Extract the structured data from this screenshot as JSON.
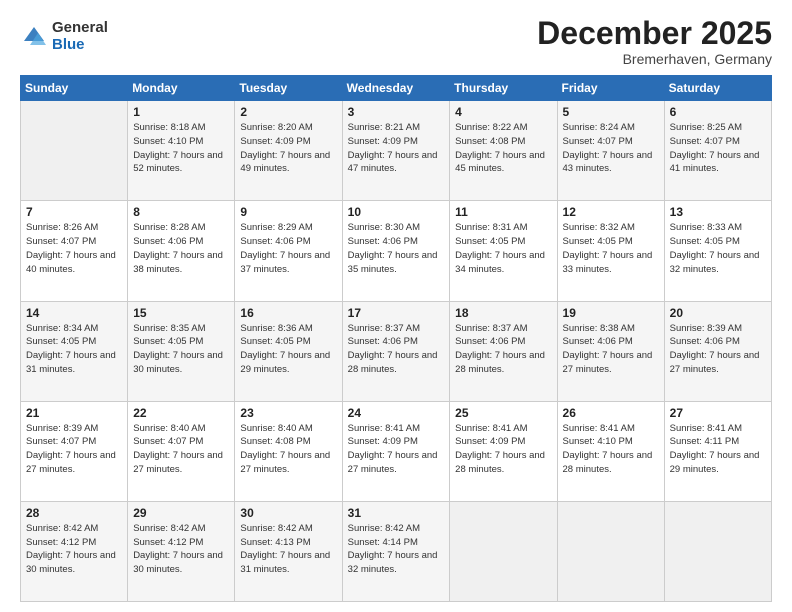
{
  "logo": {
    "general": "General",
    "blue": "Blue"
  },
  "header": {
    "title": "December 2025",
    "location": "Bremerhaven, Germany"
  },
  "weekdays": [
    "Sunday",
    "Monday",
    "Tuesday",
    "Wednesday",
    "Thursday",
    "Friday",
    "Saturday"
  ],
  "weeks": [
    [
      null,
      {
        "day": "1",
        "sunrise": "Sunrise: 8:18 AM",
        "sunset": "Sunset: 4:10 PM",
        "daylight": "Daylight: 7 hours and 52 minutes."
      },
      {
        "day": "2",
        "sunrise": "Sunrise: 8:20 AM",
        "sunset": "Sunset: 4:09 PM",
        "daylight": "Daylight: 7 hours and 49 minutes."
      },
      {
        "day": "3",
        "sunrise": "Sunrise: 8:21 AM",
        "sunset": "Sunset: 4:09 PM",
        "daylight": "Daylight: 7 hours and 47 minutes."
      },
      {
        "day": "4",
        "sunrise": "Sunrise: 8:22 AM",
        "sunset": "Sunset: 4:08 PM",
        "daylight": "Daylight: 7 hours and 45 minutes."
      },
      {
        "day": "5",
        "sunrise": "Sunrise: 8:24 AM",
        "sunset": "Sunset: 4:07 PM",
        "daylight": "Daylight: 7 hours and 43 minutes."
      },
      {
        "day": "6",
        "sunrise": "Sunrise: 8:25 AM",
        "sunset": "Sunset: 4:07 PM",
        "daylight": "Daylight: 7 hours and 41 minutes."
      }
    ],
    [
      {
        "day": "7",
        "sunrise": "Sunrise: 8:26 AM",
        "sunset": "Sunset: 4:07 PM",
        "daylight": "Daylight: 7 hours and 40 minutes."
      },
      {
        "day": "8",
        "sunrise": "Sunrise: 8:28 AM",
        "sunset": "Sunset: 4:06 PM",
        "daylight": "Daylight: 7 hours and 38 minutes."
      },
      {
        "day": "9",
        "sunrise": "Sunrise: 8:29 AM",
        "sunset": "Sunset: 4:06 PM",
        "daylight": "Daylight: 7 hours and 37 minutes."
      },
      {
        "day": "10",
        "sunrise": "Sunrise: 8:30 AM",
        "sunset": "Sunset: 4:06 PM",
        "daylight": "Daylight: 7 hours and 35 minutes."
      },
      {
        "day": "11",
        "sunrise": "Sunrise: 8:31 AM",
        "sunset": "Sunset: 4:05 PM",
        "daylight": "Daylight: 7 hours and 34 minutes."
      },
      {
        "day": "12",
        "sunrise": "Sunrise: 8:32 AM",
        "sunset": "Sunset: 4:05 PM",
        "daylight": "Daylight: 7 hours and 33 minutes."
      },
      {
        "day": "13",
        "sunrise": "Sunrise: 8:33 AM",
        "sunset": "Sunset: 4:05 PM",
        "daylight": "Daylight: 7 hours and 32 minutes."
      }
    ],
    [
      {
        "day": "14",
        "sunrise": "Sunrise: 8:34 AM",
        "sunset": "Sunset: 4:05 PM",
        "daylight": "Daylight: 7 hours and 31 minutes."
      },
      {
        "day": "15",
        "sunrise": "Sunrise: 8:35 AM",
        "sunset": "Sunset: 4:05 PM",
        "daylight": "Daylight: 7 hours and 30 minutes."
      },
      {
        "day": "16",
        "sunrise": "Sunrise: 8:36 AM",
        "sunset": "Sunset: 4:05 PM",
        "daylight": "Daylight: 7 hours and 29 minutes."
      },
      {
        "day": "17",
        "sunrise": "Sunrise: 8:37 AM",
        "sunset": "Sunset: 4:06 PM",
        "daylight": "Daylight: 7 hours and 28 minutes."
      },
      {
        "day": "18",
        "sunrise": "Sunrise: 8:37 AM",
        "sunset": "Sunset: 4:06 PM",
        "daylight": "Daylight: 7 hours and 28 minutes."
      },
      {
        "day": "19",
        "sunrise": "Sunrise: 8:38 AM",
        "sunset": "Sunset: 4:06 PM",
        "daylight": "Daylight: 7 hours and 27 minutes."
      },
      {
        "day": "20",
        "sunrise": "Sunrise: 8:39 AM",
        "sunset": "Sunset: 4:06 PM",
        "daylight": "Daylight: 7 hours and 27 minutes."
      }
    ],
    [
      {
        "day": "21",
        "sunrise": "Sunrise: 8:39 AM",
        "sunset": "Sunset: 4:07 PM",
        "daylight": "Daylight: 7 hours and 27 minutes."
      },
      {
        "day": "22",
        "sunrise": "Sunrise: 8:40 AM",
        "sunset": "Sunset: 4:07 PM",
        "daylight": "Daylight: 7 hours and 27 minutes."
      },
      {
        "day": "23",
        "sunrise": "Sunrise: 8:40 AM",
        "sunset": "Sunset: 4:08 PM",
        "daylight": "Daylight: 7 hours and 27 minutes."
      },
      {
        "day": "24",
        "sunrise": "Sunrise: 8:41 AM",
        "sunset": "Sunset: 4:09 PM",
        "daylight": "Daylight: 7 hours and 27 minutes."
      },
      {
        "day": "25",
        "sunrise": "Sunrise: 8:41 AM",
        "sunset": "Sunset: 4:09 PM",
        "daylight": "Daylight: 7 hours and 28 minutes."
      },
      {
        "day": "26",
        "sunrise": "Sunrise: 8:41 AM",
        "sunset": "Sunset: 4:10 PM",
        "daylight": "Daylight: 7 hours and 28 minutes."
      },
      {
        "day": "27",
        "sunrise": "Sunrise: 8:41 AM",
        "sunset": "Sunset: 4:11 PM",
        "daylight": "Daylight: 7 hours and 29 minutes."
      }
    ],
    [
      {
        "day": "28",
        "sunrise": "Sunrise: 8:42 AM",
        "sunset": "Sunset: 4:12 PM",
        "daylight": "Daylight: 7 hours and 30 minutes."
      },
      {
        "day": "29",
        "sunrise": "Sunrise: 8:42 AM",
        "sunset": "Sunset: 4:12 PM",
        "daylight": "Daylight: 7 hours and 30 minutes."
      },
      {
        "day": "30",
        "sunrise": "Sunrise: 8:42 AM",
        "sunset": "Sunset: 4:13 PM",
        "daylight": "Daylight: 7 hours and 31 minutes."
      },
      {
        "day": "31",
        "sunrise": "Sunrise: 8:42 AM",
        "sunset": "Sunset: 4:14 PM",
        "daylight": "Daylight: 7 hours and 32 minutes."
      },
      null,
      null,
      null
    ]
  ]
}
